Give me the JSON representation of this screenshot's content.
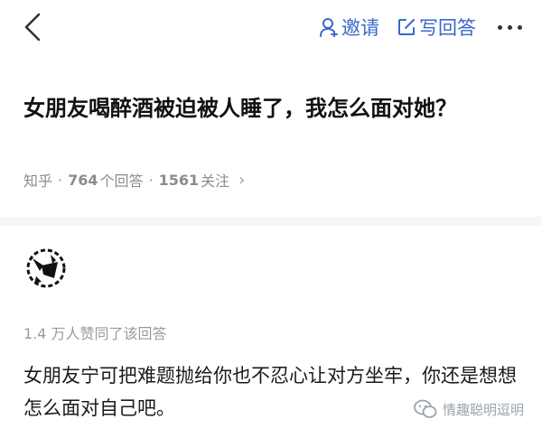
{
  "header": {
    "invite_label": "邀请",
    "write_answer_label": "写回答",
    "back_icon": "chevron-left-icon",
    "invite_icon": "person-icon",
    "write_icon": "pencil-square-icon",
    "more_icon": "more-dots-icon",
    "accent_color": "#3a68c8"
  },
  "question": {
    "title": "女朋友喝醉酒被迫被人睡了，我怎么面对她？",
    "source": "知乎",
    "answer_count": "764",
    "answer_label": "个回答",
    "follower_count": "1561",
    "follower_label": "关注",
    "separator": "·",
    "chevron": "›"
  },
  "answer": {
    "vote_text": "1.4 万人赞同了该回答",
    "body": "女朋友宁可把难题抛给你也不忍心让对方坐牢，你还是想想怎么面对自己吧。"
  },
  "watermark": {
    "text": "情趣聪明逗明"
  }
}
